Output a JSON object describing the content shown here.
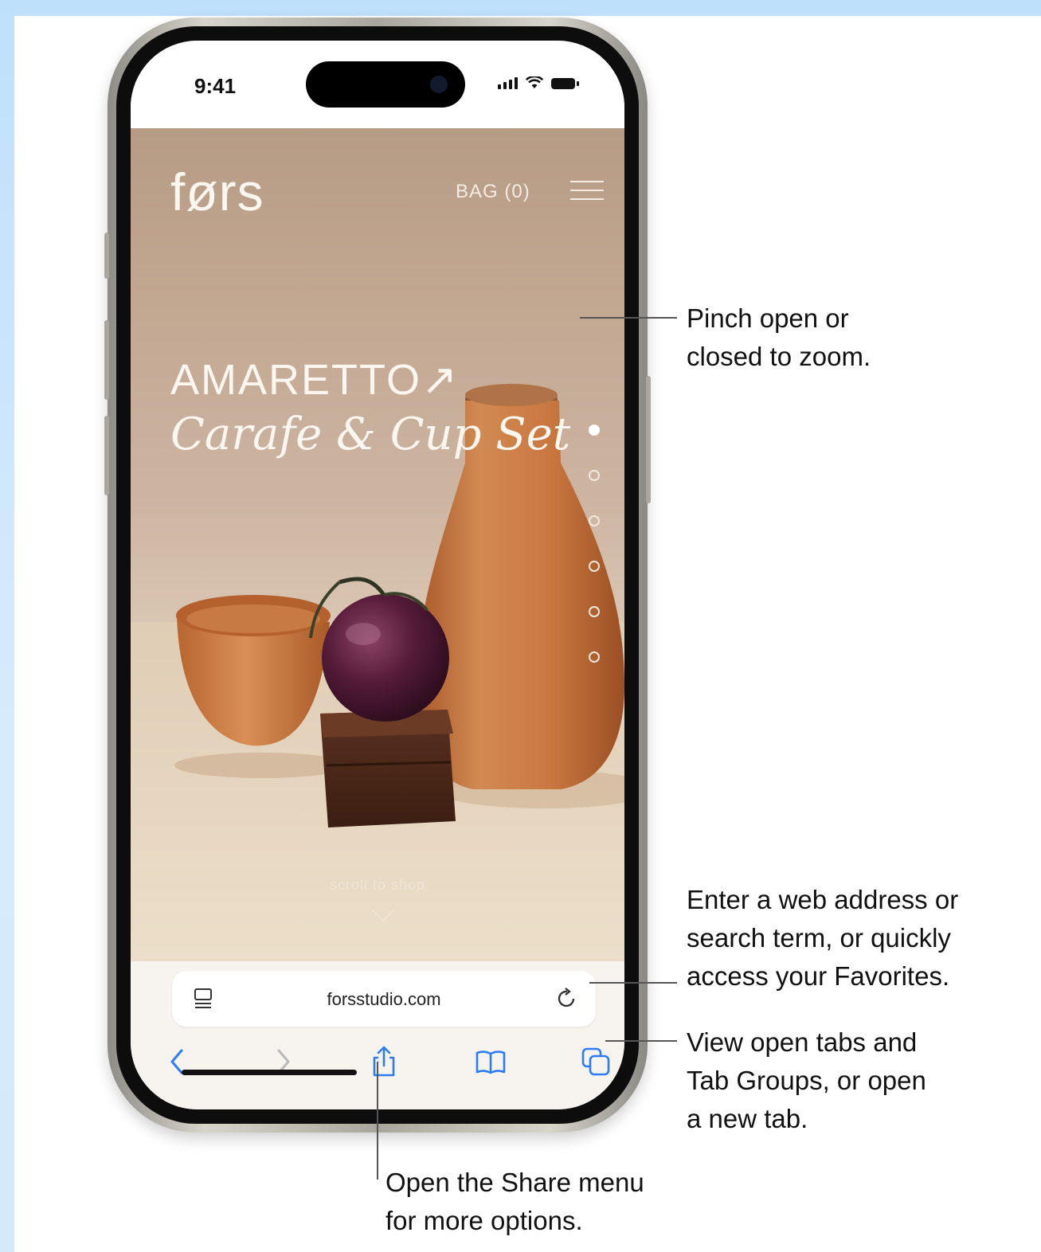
{
  "status_bar": {
    "time": "9:41"
  },
  "website": {
    "logo": "førs",
    "bag_label": "BAG (0)",
    "hero_title": "AMARETTO",
    "hero_title_arrow": "↗",
    "hero_subtitle": "Carafe & Cup Set",
    "scroll_label": "scroll to shop",
    "carousel_total": 6,
    "carousel_active_index": 0
  },
  "safari": {
    "address": "forsstudio.com",
    "toolbar_buttons": [
      "back",
      "forward",
      "share",
      "bookmarks",
      "tabs"
    ]
  },
  "callouts": {
    "zoom": [
      "Pinch open or",
      "closed to zoom."
    ],
    "address": [
      "Enter a web address or",
      "search term, or quickly",
      "access your Favorites."
    ],
    "tabs": [
      "View open tabs and",
      "Tab Groups, or open",
      "a new tab."
    ],
    "share": [
      "Open the Share menu",
      "for more options."
    ]
  },
  "colors": {
    "background": "#cfe7fb",
    "link_blue": "#2c7cf6",
    "terracotta": "#c8793f",
    "plum": "#4a1630"
  }
}
